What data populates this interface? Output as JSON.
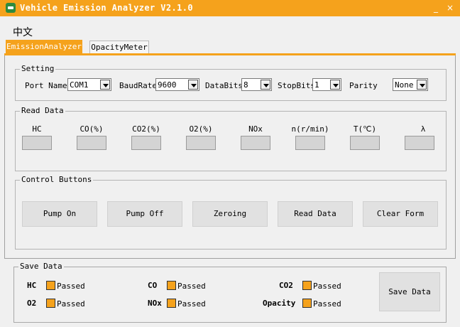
{
  "window": {
    "title": "Vehicle Emission Analyzer V2.1.0",
    "minimize": "_",
    "close": "×"
  },
  "language": "中文",
  "tabs": [
    {
      "label": "EmissionAnalyzer"
    },
    {
      "label": "OpacityMeter"
    }
  ],
  "setting": {
    "legend": "Setting",
    "port_name_label": "Port Name",
    "port_name_value": "COM1",
    "baud_label": "BaudRate",
    "baud_value": "9600",
    "databits_label": "DataBits",
    "databits_value": "8",
    "stopbits_label": "StopBits",
    "stopbits_value": "1",
    "parity_label": "Parity",
    "parity_value": "None"
  },
  "read_data": {
    "legend": "Read Data",
    "fields": [
      "HC",
      "CO(%)",
      "CO2(%)",
      "O2(%)",
      "NOx",
      "n(r/min)",
      "T(℃)",
      "λ"
    ],
    "values": [
      "",
      "",
      "",
      "",
      "",
      "",
      "",
      ""
    ]
  },
  "control": {
    "legend": "Control Buttons",
    "buttons": [
      "Pump On",
      "Pump Off",
      "Zeroing",
      "Read Data",
      "Clear Form"
    ]
  },
  "save": {
    "legend": "Save Data",
    "items": [
      {
        "label": "HC",
        "status": "Passed"
      },
      {
        "label": "CO",
        "status": "Passed"
      },
      {
        "label": "CO2",
        "status": "Passed"
      },
      {
        "label": "O2",
        "status": "Passed"
      },
      {
        "label": "NOx",
        "status": "Passed"
      },
      {
        "label": "Opacity",
        "status": "Passed"
      }
    ],
    "button": "Save Data"
  },
  "colors": {
    "accent": "#f5a21c"
  }
}
